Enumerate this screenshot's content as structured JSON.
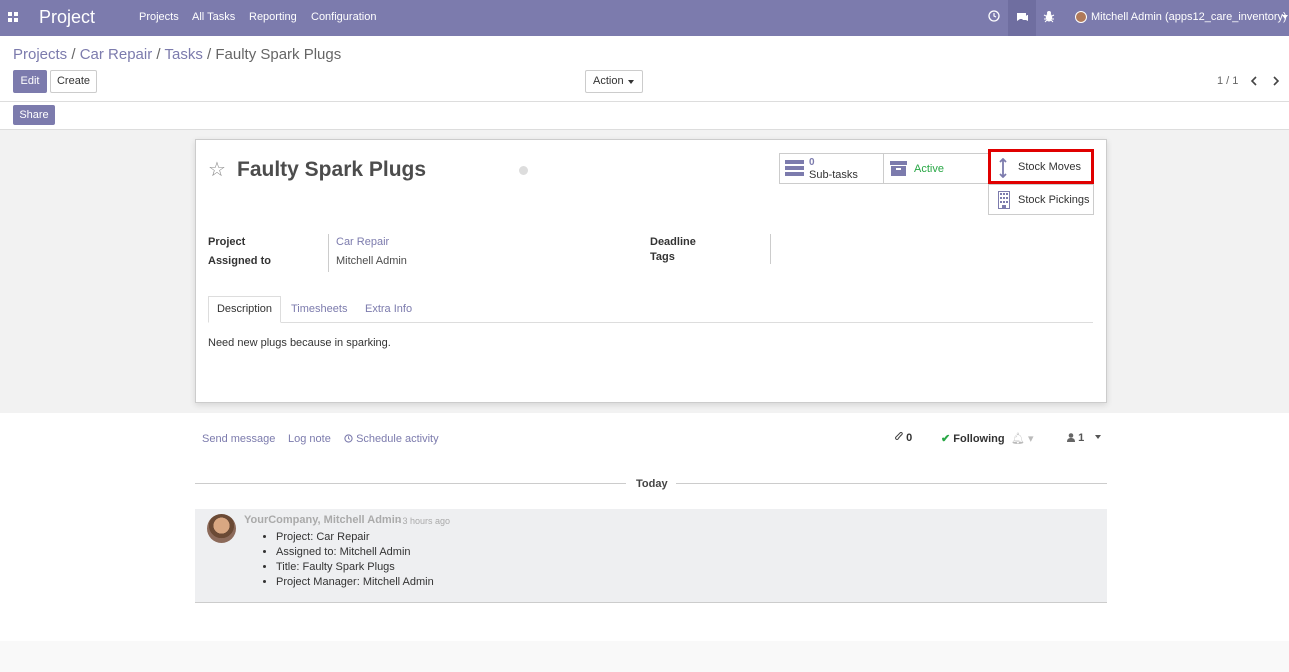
{
  "topbar": {
    "app_name": "Project",
    "menu": [
      "Projects",
      "All Tasks",
      "Reporting",
      "Configuration"
    ],
    "user": "Mitchell Admin (apps12_care_inventory)"
  },
  "breadcrumb": {
    "items": [
      "Projects",
      "Car Repair",
      "Tasks"
    ],
    "current": "Faulty Spark Plugs",
    "sep": "/"
  },
  "buttons": {
    "edit": "Edit",
    "create": "Create",
    "action": "Action",
    "share": "Share"
  },
  "pager": {
    "text": "1 / 1"
  },
  "task": {
    "title": "Faulty Spark Plugs",
    "smart": {
      "subtasks_count": "0",
      "subtasks_label": "Sub-tasks",
      "active_label": "Active",
      "stock_moves": "Stock Moves",
      "stock_pickings": "Stock Pickings"
    },
    "fields": {
      "project_label": "Project",
      "project_value": "Car Repair",
      "assigned_label": "Assigned to",
      "assigned_value": "Mitchell Admin",
      "deadline_label": "Deadline",
      "tags_label": "Tags"
    },
    "tabs": [
      "Description",
      "Timesheets",
      "Extra Info"
    ],
    "description": "Need new plugs because in sparking."
  },
  "chatter": {
    "send_message": "Send message",
    "log_note": "Log note",
    "schedule": "Schedule activity",
    "attachments": "0",
    "following": "Following",
    "followers": "1",
    "today": "Today",
    "message": {
      "author": "YourCompany, Mitchell Admin",
      "time": "- 3 hours ago",
      "items": [
        "Project: Car Repair",
        "Assigned to: Mitchell Admin",
        "Title: Faulty Spark Plugs",
        "Project Manager: Mitchell Admin"
      ]
    }
  },
  "colors": {
    "brand": "#7c7bad",
    "active": "#28a745",
    "highlight": "#e00000"
  }
}
